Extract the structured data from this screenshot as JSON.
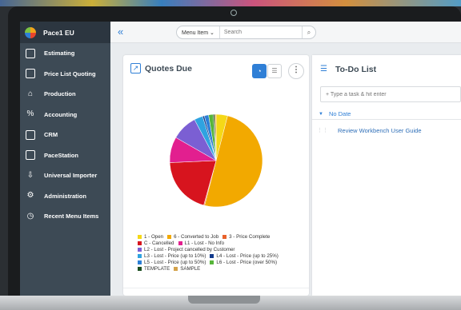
{
  "app": {
    "brand": "Pace1 EU"
  },
  "sidebar": {
    "items": [
      {
        "label": "Estimating",
        "icon": "calculator-icon"
      },
      {
        "label": "Price List Quoting",
        "icon": "list-icon"
      },
      {
        "label": "Production",
        "icon": "factory-icon"
      },
      {
        "label": "Accounting",
        "icon": "percent-icon"
      },
      {
        "label": "CRM",
        "icon": "contacts-icon"
      },
      {
        "label": "PaceStation",
        "icon": "station-icon"
      },
      {
        "label": "Universal Importer",
        "icon": "import-icon"
      },
      {
        "label": "Administration",
        "icon": "admin-icon"
      },
      {
        "label": "Recent Menu Items",
        "icon": "clock-icon"
      }
    ]
  },
  "topbar": {
    "menu_select": "Menu Item ⌄",
    "search_placeholder": "Search"
  },
  "quotes": {
    "title": "Quotes Due"
  },
  "chart_data": {
    "type": "pie",
    "series": [
      {
        "label": "1 - Open",
        "value": 4,
        "color": "#f5d817"
      },
      {
        "label": "6 - Converted to Job",
        "value": 50,
        "color": "#f2a900"
      },
      {
        "label": "3 - Price Complete",
        "value": 0.3,
        "color": "#e8622c"
      },
      {
        "label": "C - Cancelled",
        "value": 20,
        "color": "#d7141e"
      },
      {
        "label": "L1 - Lost - No Info",
        "value": 9,
        "color": "#e21f8f"
      },
      {
        "label": "L2 - Lost - Project cancelled by Customer",
        "value": 9,
        "color": "#7b5fd3"
      },
      {
        "label": "L3 - Lost - Price (up to 10%)",
        "value": 3,
        "color": "#2fa3e0"
      },
      {
        "label": "L4 - Lost - Price (up to 25%)",
        "value": 0.6,
        "color": "#123a8c"
      },
      {
        "label": "L5 - Lost - Price (up to 50%)",
        "value": 1.5,
        "color": "#2c7fd6"
      },
      {
        "label": "L6 - Lost - Price (over 50%)",
        "value": 1.6,
        "color": "#57b53a"
      },
      {
        "label": "TEMPLATE",
        "value": 0.5,
        "color": "#1a4d1e"
      },
      {
        "label": "SAMPLE",
        "value": 0.5,
        "color": "#d4a24a"
      }
    ]
  },
  "todo": {
    "title": "To-Do List",
    "input_placeholder": "+ Type a task & hit enter",
    "group": "No Date",
    "tasks": [
      "Review Workbench User Guide"
    ]
  }
}
